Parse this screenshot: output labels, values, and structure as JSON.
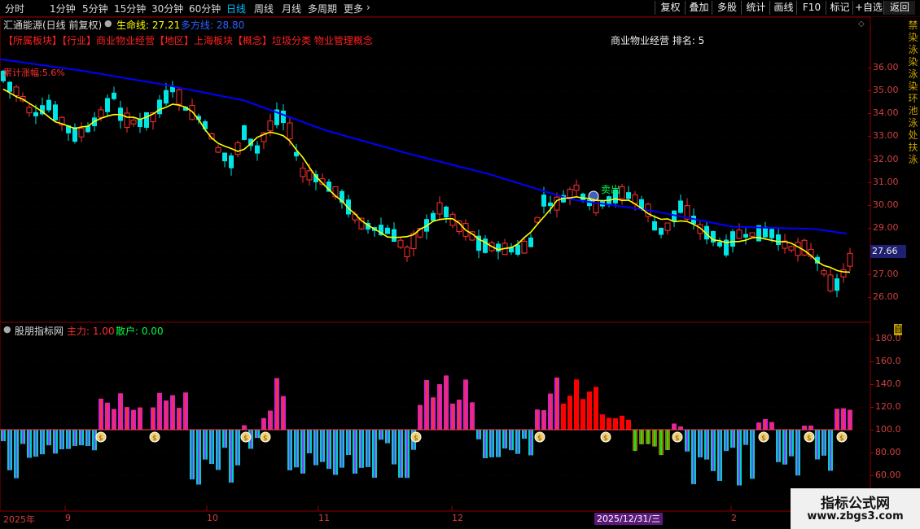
{
  "toolbar": {
    "timeframes": [
      "分时",
      "1分钟",
      "5分钟",
      "15分钟",
      "30分钟",
      "60分钟",
      "日线",
      "周线",
      "月线",
      "多周期",
      "更多"
    ],
    "active_timeframe": "日线",
    "right_buttons": [
      "复权",
      "叠加",
      "多股",
      "统计",
      "画线",
      "F10",
      "标记",
      "+自选",
      "返回"
    ]
  },
  "main_chart": {
    "title": "汇通能源(日线 前复权)",
    "indicator1_label": "生命线: 27.21",
    "indicator2_label": "多方线: 28.80",
    "tags": "【所属板块】【行业】商业物业经营【地区】上海板块【概念】垃圾分类 物业管理概念",
    "rank_text": "商业物业经营 排名: 5",
    "gain_text": "累计涨幅:5.6%",
    "sell_label": "卖出",
    "current_price": "27.66",
    "price_axis": [
      "36.00",
      "35.00",
      "34.00",
      "33.00",
      "32.00",
      "31.00",
      "30.00",
      "29.00",
      "28.00",
      "27.00",
      "26.00"
    ],
    "colors": {
      "up": "#ff3030",
      "down": "#00e5e5",
      "lifeline": "#ffff00",
      "bullline": "#0000ff"
    }
  },
  "indicator_panel": {
    "title": "股朋指标网",
    "main_label": "主力: 1.00",
    "retail_label": "散户: 0.00",
    "axis": [
      "180.0",
      "160.0",
      "140.0",
      "120.0",
      "100.0",
      "80.00",
      "60.00"
    ],
    "edge_char": "自"
  },
  "date_axis": {
    "labels": [
      "2025年",
      "9",
      "10",
      "11",
      "12",
      "1",
      "2"
    ],
    "cursor_date": "2025/12/31/三"
  },
  "watermark": {
    "title": "指标公式网",
    "url": "www.zbgs3.com"
  },
  "side_text": "禁染泳染泳染环池泳处扶泳"
}
